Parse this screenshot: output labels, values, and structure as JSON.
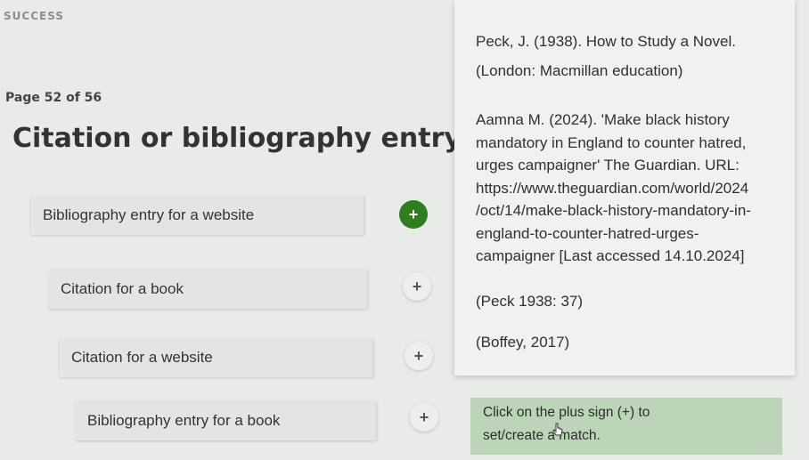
{
  "logo": {
    "text": "SUCCESS"
  },
  "page_indicator": "Page 52 of 56",
  "title": "Citation or bibliography entry?",
  "rows": [
    {
      "label": "Bibliography entry for a website",
      "button": "+",
      "selected": true
    },
    {
      "label": "Citation for a book",
      "button": "+",
      "selected": false
    },
    {
      "label": "Citation for a website",
      "button": "+",
      "selected": false
    },
    {
      "label": "Bibliography entry for a book",
      "button": "+",
      "selected": false
    }
  ],
  "answers": [
    {
      "lines": [
        "Peck, J. (1938). How to Study a Novel.",
        "(London: Macmillan education)"
      ]
    },
    {
      "lines": [
        "Aamna M. (2024). 'Make black history",
        "mandatory in England to counter hatred,",
        "urges campaigner' The Guardian. URL:",
        "https://www.theguardian.com/world/2024",
        "/oct/14/make-black-history-mandatory-in-",
        "england-to-counter-hatred-urges-",
        "campaigner [Last accessed 14.10.2024]"
      ]
    },
    {
      "lines": [
        "(Peck 1938: 37)"
      ]
    },
    {
      "lines": [
        "(Boffey, 2017)"
      ]
    }
  ],
  "instructions": {
    "line1": "Click on the plus sign (+) to",
    "line2": "set/create a match."
  },
  "colors": {
    "selected_plus": "#2e7d1f",
    "instruction_bg": "#bcd5b8"
  }
}
